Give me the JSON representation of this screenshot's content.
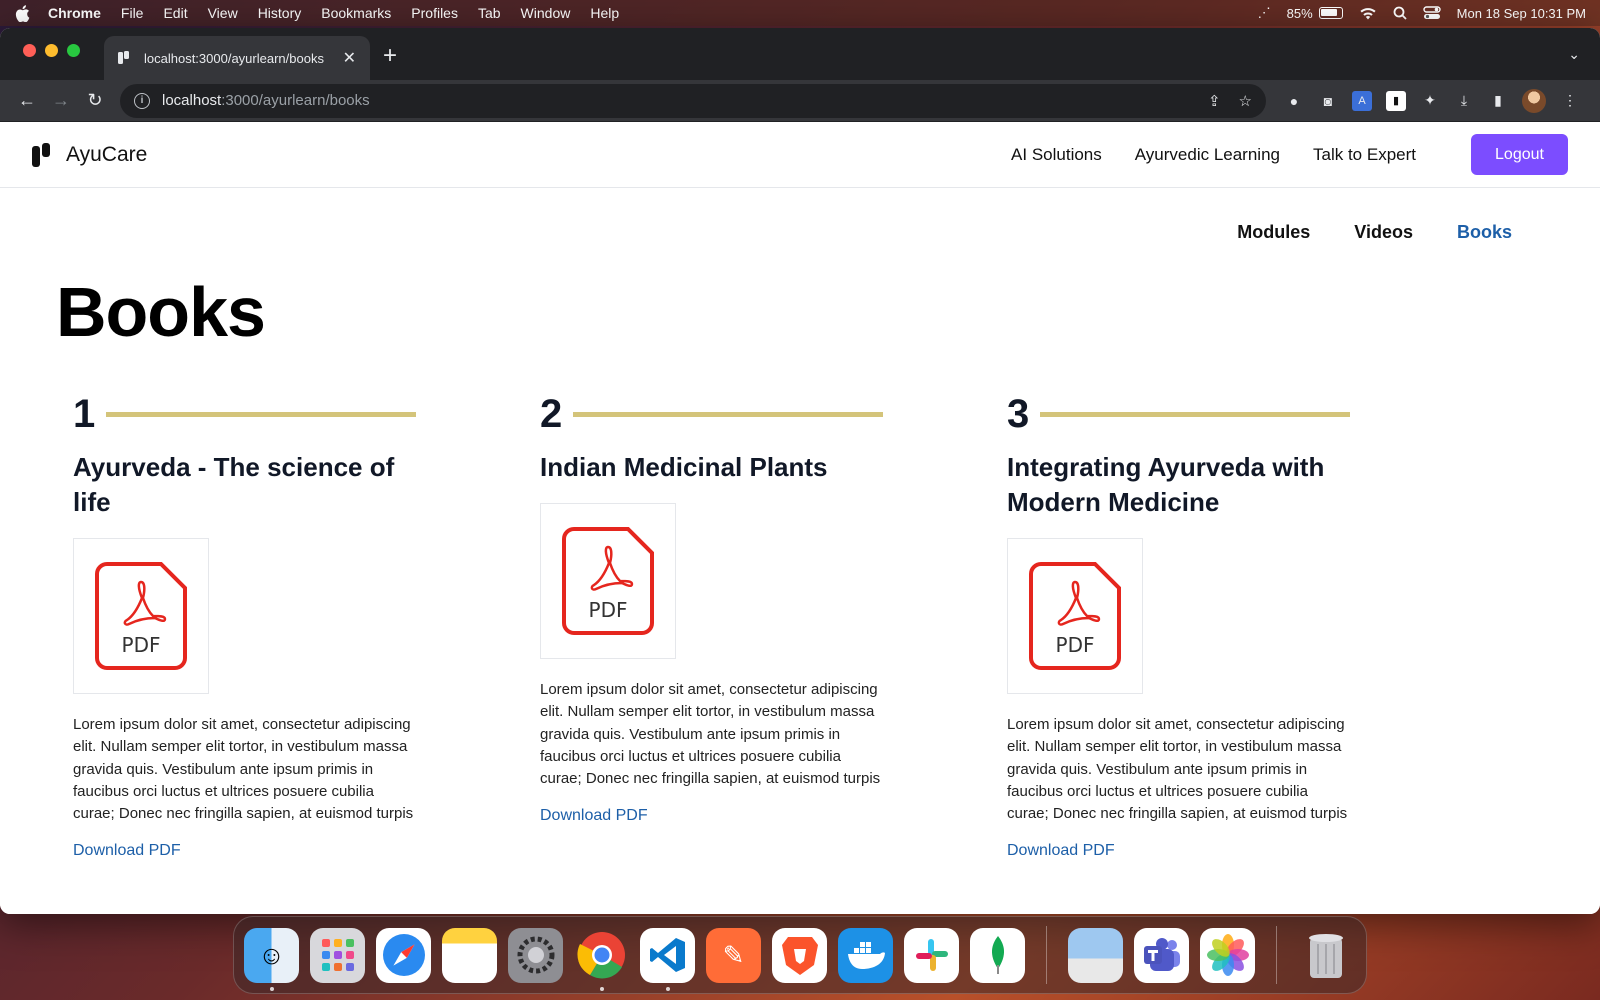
{
  "menubar": {
    "app_name": "Chrome",
    "menus": [
      "File",
      "Edit",
      "View",
      "History",
      "Bookmarks",
      "Profiles",
      "Tab",
      "Window",
      "Help"
    ],
    "battery": "85%",
    "datetime": "Mon 18 Sep  10:31 PM"
  },
  "browser": {
    "tab_title": "localhost:3000/ayurlearn/books",
    "url_host": "localhost",
    "url_path": ":3000/ayurlearn/books"
  },
  "site": {
    "brand": "AyuCare",
    "nav": [
      "AI Solutions",
      "Ayurvedic Learning",
      "Talk to Expert"
    ],
    "logout_label": "Logout",
    "subnav": [
      "Modules",
      "Videos",
      "Books"
    ],
    "subnav_active": "Books",
    "page_title": "Books"
  },
  "books": [
    {
      "number": "1",
      "title": "Ayurveda - The science of life",
      "thumb_label": "PDF",
      "description": "Lorem ipsum dolor sit amet, consectetur adipiscing elit. Nullam semper elit tortor, in vestibulum massa gravida quis. Vestibulum ante ipsum primis in faucibus orci luctus et ultrices posuere cubilia curae; Donec nec fringilla sapien, at euismod turpis",
      "link_label": "Download PDF"
    },
    {
      "number": "2",
      "title": "Indian Medicinal Plants",
      "thumb_label": "PDF",
      "description": "Lorem ipsum dolor sit amet, consectetur adipiscing elit. Nullam semper elit tortor, in vestibulum massa gravida quis. Vestibulum ante ipsum primis in faucibus orci luctus et ultrices posuere cubilia curae; Donec nec fringilla sapien, at euismod turpis",
      "link_label": "Download PDF"
    },
    {
      "number": "3",
      "title": "Integrating Ayurveda with Modern Medicine",
      "thumb_label": "PDF",
      "description": "Lorem ipsum dolor sit amet, consectetur adipiscing elit. Nullam semper elit tortor, in vestibulum massa gravida quis. Vestibulum ante ipsum primis in faucibus orci luctus et ultrices posuere cubilia curae; Donec nec fringilla sapien, at euismod turpis",
      "link_label": "Download PDF"
    }
  ],
  "colors": {
    "accent": "#7c4dff",
    "link": "#1d5fa8",
    "rule": "#d4c47a",
    "pdf_red": "#e5261e"
  },
  "dock": [
    "finder-icon",
    "launchpad-icon",
    "safari-icon",
    "notes-icon",
    "system-settings-icon",
    "chrome-icon",
    "vscode-icon",
    "postman-icon",
    "brave-icon",
    "docker-icon",
    "slack-icon",
    "mongodb-compass-icon",
    "preview-icon",
    "teams-icon",
    "photos-icon",
    "trash-icon"
  ]
}
